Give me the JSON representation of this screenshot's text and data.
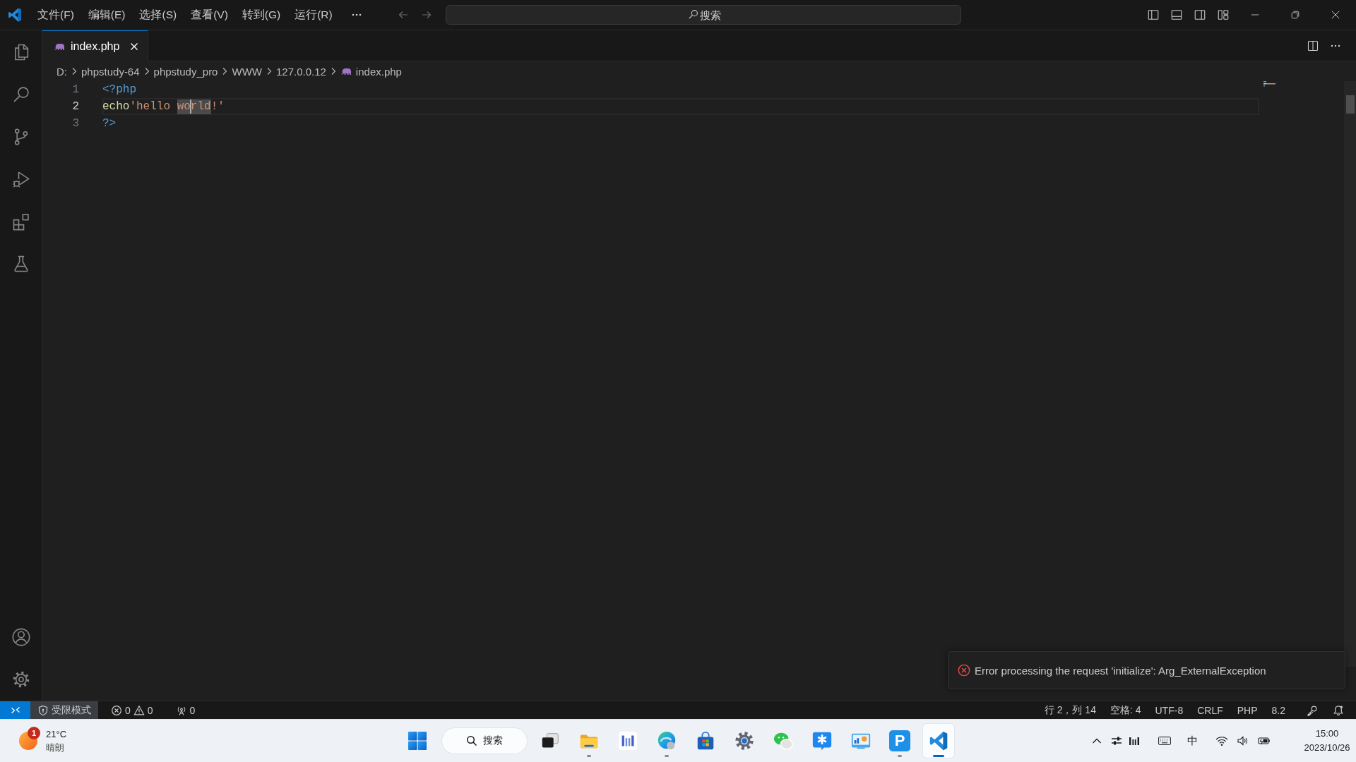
{
  "title_bar": {
    "menu": [
      "文件(F)",
      "编辑(E)",
      "选择(S)",
      "查看(V)",
      "转到(G)",
      "运行(R)"
    ],
    "search": {
      "placeholder": "搜索"
    }
  },
  "tabs": [
    {
      "label": "index.php",
      "selected": true
    }
  ],
  "breadcrumbs": [
    {
      "label": "D:",
      "kind": "folder"
    },
    {
      "label": "phpstudy-64",
      "kind": "folder"
    },
    {
      "label": "phpstudy_pro",
      "kind": "folder"
    },
    {
      "label": "WWW",
      "kind": "folder"
    },
    {
      "label": "127.0.0.12",
      "kind": "folder"
    },
    {
      "label": "index.php",
      "kind": "file"
    }
  ],
  "editor": {
    "lines": [
      {
        "number": "1",
        "current": false,
        "tokens": [
          {
            "kind": "tag",
            "text": "<?php",
            "highlight": false,
            "caret": false
          }
        ]
      },
      {
        "number": "2",
        "current": true,
        "tokens": [
          {
            "kind": "function",
            "text": "echo",
            "highlight": false,
            "caret": false
          },
          {
            "kind": "string",
            "text": "'hello ",
            "highlight": false,
            "caret": false
          },
          {
            "kind": "string",
            "text": "wo",
            "highlight": true,
            "caret": true
          },
          {
            "kind": "string",
            "text": "rld",
            "highlight": true,
            "caret": false
          },
          {
            "kind": "string",
            "text": "!'",
            "highlight": false,
            "caret": false
          }
        ]
      },
      {
        "number": "3",
        "current": false,
        "tokens": [
          {
            "kind": "tag",
            "text": "?>",
            "highlight": false,
            "caret": false
          }
        ]
      }
    ]
  },
  "notification": {
    "kind": "error",
    "message": "Error processing the request 'initialize': Arg_ExternalException"
  },
  "status_bar": {
    "restricted_mode": "受限模式",
    "errors": "0",
    "warnings": "0",
    "ports": "0",
    "items": [
      "行 2，列 14",
      "空格: 4",
      "UTF-8",
      "CRLF",
      "PHP",
      "8.2"
    ]
  },
  "taskbar": {
    "weather": {
      "badge": "1",
      "temperature": "21°C",
      "condition": "晴朗"
    },
    "search": {
      "label": "搜索"
    },
    "apps": [
      {
        "running": false,
        "active": false
      },
      {
        "running": true,
        "active": false
      },
      {
        "running": false,
        "active": false
      },
      {
        "running": true,
        "active": false
      },
      {
        "running": false,
        "active": false
      },
      {
        "running": false,
        "active": false
      },
      {
        "running": false,
        "active": false
      },
      {
        "running": false,
        "active": false
      },
      {
        "running": false,
        "active": false
      },
      {
        "letter": "P",
        "running": true,
        "active": false
      },
      {
        "running": true,
        "active": true
      }
    ],
    "input_method": "中",
    "clock": {
      "time": "15:00",
      "date": "2023/10/26"
    }
  }
}
